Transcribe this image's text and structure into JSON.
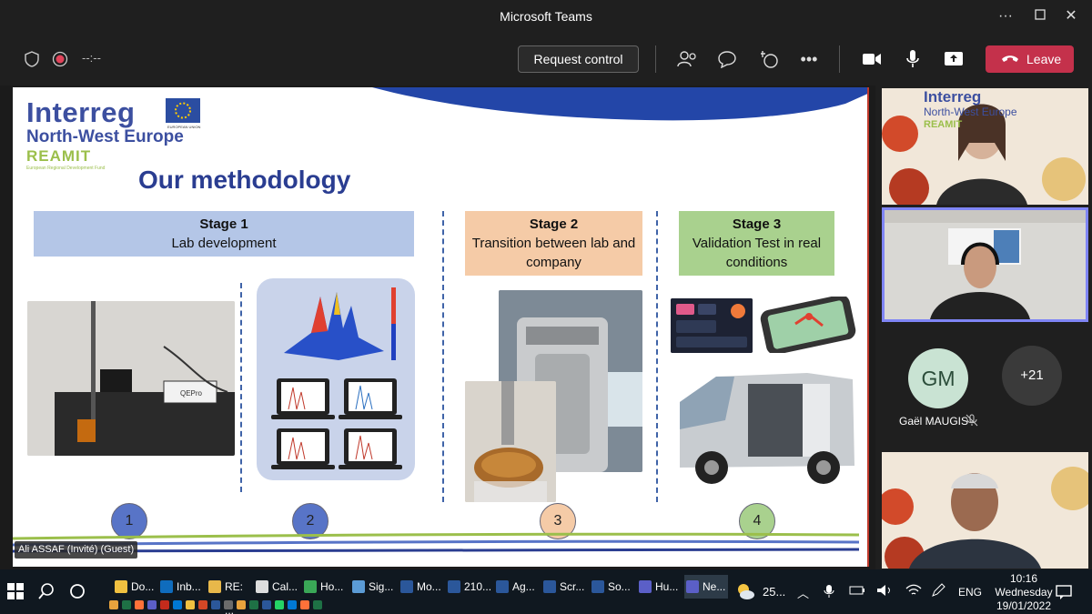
{
  "window": {
    "title": "Microsoft Teams"
  },
  "toolbar": {
    "timer": "--:--",
    "request_control": "Request control",
    "leave": "Leave"
  },
  "slide": {
    "logo_line1": "Interreg",
    "logo_line2": "North-West Europe",
    "logo_line3": "REAMIT",
    "logo_line4": "European Regional Development Fund",
    "eu_label": "EUROPEAN UNION",
    "title": "Our methodology",
    "stage1": {
      "heading": "Stage 1",
      "text": "Lab development",
      "color": "#b4c6e7"
    },
    "stage2": {
      "heading": "Stage 2",
      "text": "Transition between lab and company",
      "color": "#f5cba7"
    },
    "stage3": {
      "heading": "Stage 3",
      "text": "Validation Test in real conditions",
      "color": "#a9d18e"
    },
    "steps": [
      "1",
      "2",
      "3",
      "4"
    ],
    "spectrometer_label": "QEPro"
  },
  "presenter_tag": "Ali ASSAF (Invité) (Guest)",
  "participants": {
    "avatar_initials": "GM",
    "avatar_name": "Gaël MAUGIS",
    "overflow_count": "+21",
    "tile_logo_line1": "Interreg",
    "tile_logo_line2": "North-West Europe",
    "tile_logo_line3": "REAMIT"
  },
  "taskbar": {
    "apps": [
      {
        "label": "Do...",
        "color": "#f0c040"
      },
      {
        "label": "Inb...",
        "color": "#0f6cbd"
      },
      {
        "label": "RE: ...",
        "color": "#e8b84a"
      },
      {
        "label": "Cal...",
        "color": "#dddddd"
      },
      {
        "label": "Ho...",
        "color": "#3aa757"
      },
      {
        "label": "Sig...",
        "color": "#5b9bd5"
      },
      {
        "label": "Mo...",
        "color": "#2b579a"
      },
      {
        "label": "210...",
        "color": "#2b579a"
      },
      {
        "label": "Ag...",
        "color": "#2b579a"
      },
      {
        "label": "Scr...",
        "color": "#2b579a"
      },
      {
        "label": "So...",
        "color": "#2b579a"
      },
      {
        "label": "Hu...",
        "color": "#5b5fc7"
      },
      {
        "label": "Ne...",
        "color": "#5b5fc7"
      }
    ],
    "weather": "25...",
    "language": "ENG",
    "time": "10:16",
    "day": "Wednesday",
    "date": "19/01/2022"
  }
}
